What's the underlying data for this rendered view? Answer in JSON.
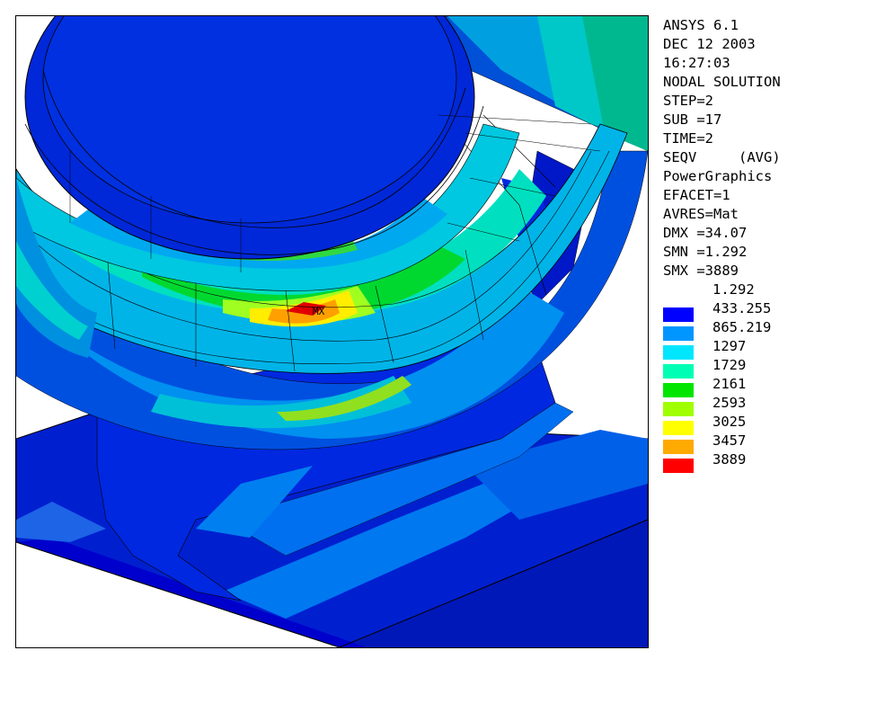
{
  "viewport": {
    "max_marker_label": "MX"
  },
  "info": {
    "lines": [
      "ANSYS 6.1",
      "DEC 12 2003",
      "16:27:03",
      "NODAL SOLUTION",
      "STEP=2",
      "SUB =17",
      "TIME=2",
      "SEQV     (AVG)",
      "PowerGraphics",
      "EFACET=1",
      "AVRES=Mat",
      "DMX =34.07",
      "SMN =1.292",
      "SMX =3889"
    ]
  },
  "legend": {
    "min_label": "1.292",
    "bands": [
      {
        "label": "433.255",
        "color": "#0000ff"
      },
      {
        "label": "865.219",
        "color": "#0096ff"
      },
      {
        "label": "1297",
        "color": "#00e6ff"
      },
      {
        "label": "1729",
        "color": "#00ffb4"
      },
      {
        "label": "2161",
        "color": "#00e600"
      },
      {
        "label": "2593",
        "color": "#a0ff00"
      },
      {
        "label": "3025",
        "color": "#ffff00"
      },
      {
        "label": "3457",
        "color": "#ffaa00"
      },
      {
        "label": "3889",
        "color": "#ff0000"
      }
    ]
  }
}
